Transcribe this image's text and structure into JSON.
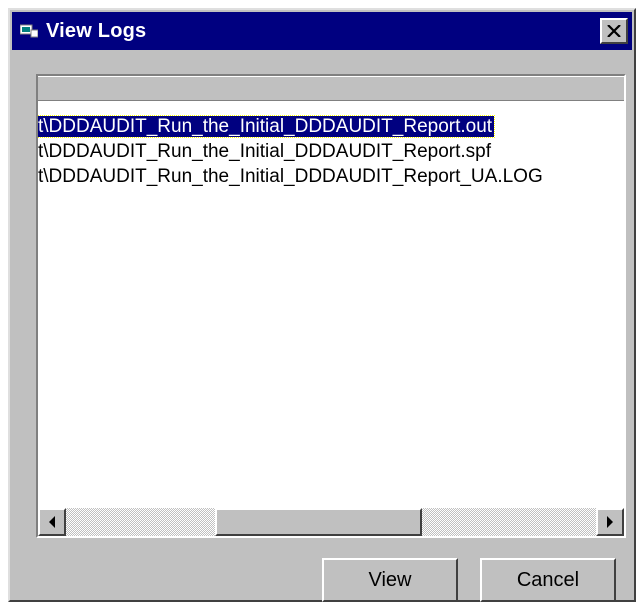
{
  "window": {
    "title": "View Logs",
    "icons": {
      "app": "app-icon",
      "close": "close-icon"
    }
  },
  "log_list": {
    "items": [
      {
        "label": "t\\DDDAUDIT_Run_the_Initial_DDDAUDIT_Report.out",
        "selected": true
      },
      {
        "label": "t\\DDDAUDIT_Run_the_Initial_DDDAUDIT_Report.spf",
        "selected": false
      },
      {
        "label": "t\\DDDAUDIT_Run_the_Initial_DDDAUDIT_Report_UA.LOG",
        "selected": false
      }
    ],
    "scrollbar": {
      "position_fraction": 0.46,
      "visible_fraction": 0.39
    }
  },
  "buttons": {
    "view_label": "View",
    "cancel_label": "Cancel"
  },
  "colors": {
    "titlebar": "#000080",
    "selection": "#000080",
    "face": "#c0c0c0"
  }
}
